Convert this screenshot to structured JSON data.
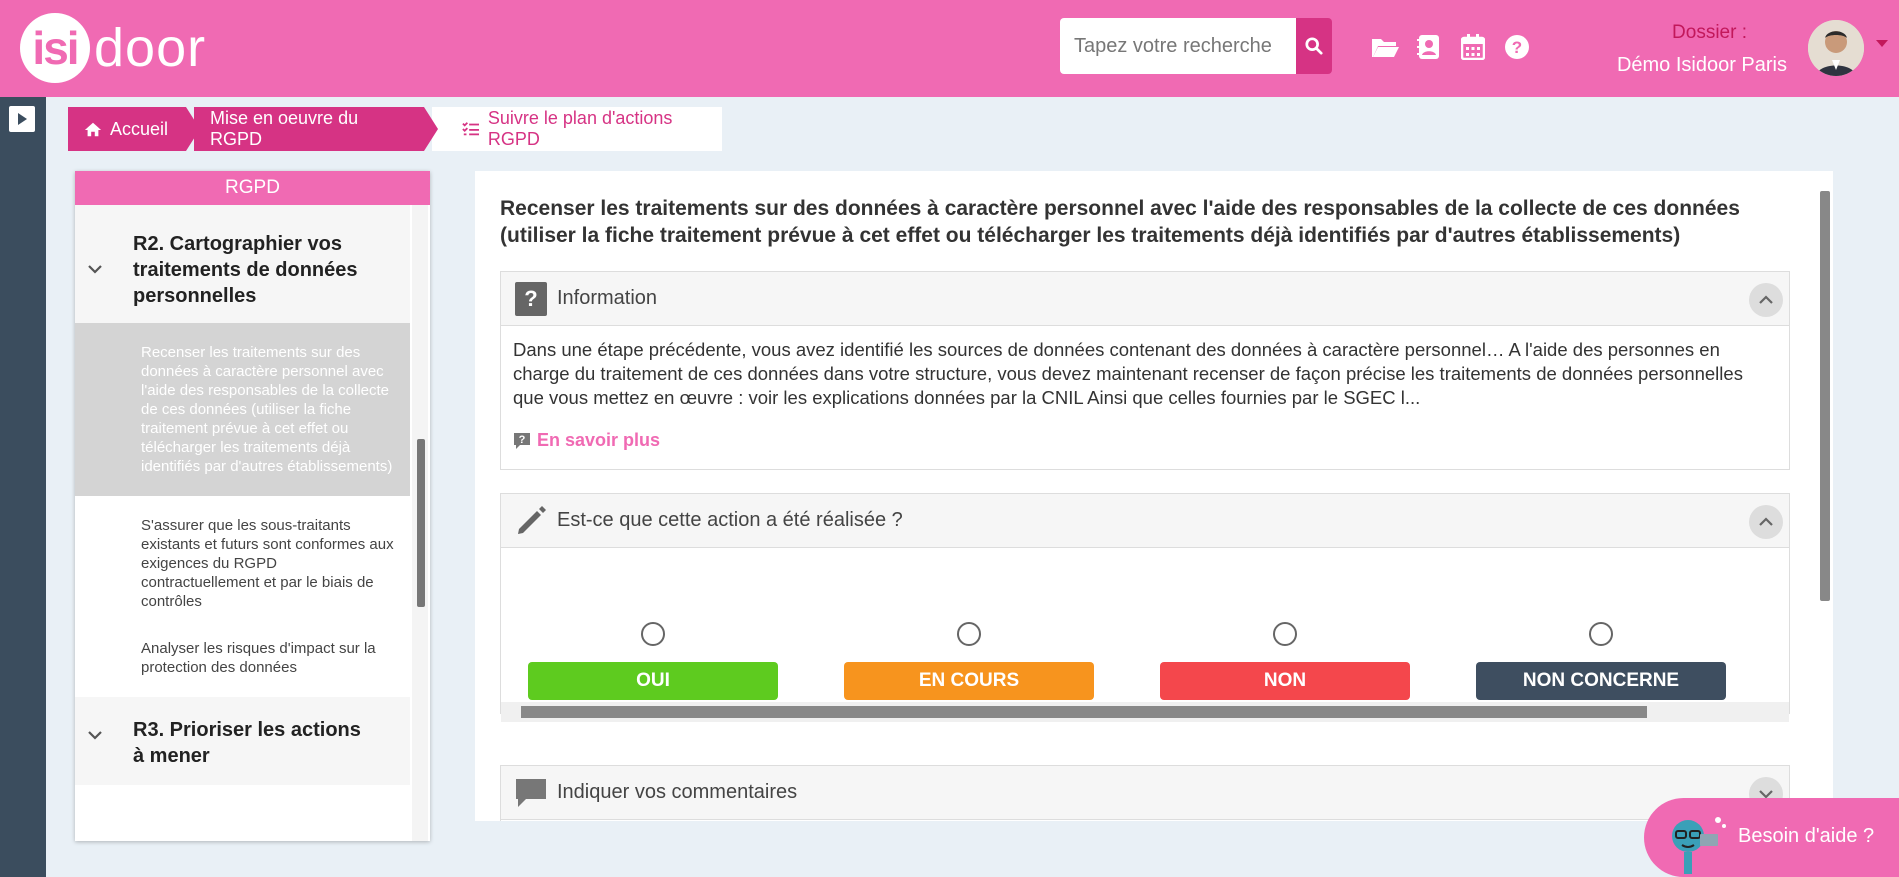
{
  "header": {
    "logo_prefix": "isi",
    "logo_suffix": "door",
    "search_placeholder": "Tapez votre recherche",
    "dossier_label": "Dossier :",
    "dossier_name": "Démo Isidoor Paris",
    "icons": [
      "folder-open-icon",
      "address-book-icon",
      "calendar-icon",
      "help-circle-icon"
    ]
  },
  "breadcrumb": {
    "home": "Accueil",
    "level2": "Mise en oeuvre du RGPD",
    "level3": "Suivre le plan d'actions RGPD"
  },
  "sidebar": {
    "title": "RGPD",
    "sections": [
      {
        "title": "R2. Cartographier vos traitements de données personnelles",
        "items": [
          "Recenser les traitements sur des données à caractère personnel (utiliser la fiche traitement prévue à cet effet ou télécharger les traitements déjà identifiés par d'autres établissements)",
          "S'assurer que les sous-traitants existants et futurs sont conformes aux exigences du RGPD contractuellement et par le biais de contrôles",
          "Analyser les risques d'impact sur la protection des données"
        ]
      },
      {
        "title": "R3. Prioriser les actions à mener",
        "items": []
      }
    ],
    "active_item": "Recenser les traitements sur des données à caractère personnel avec l'aide des responsables de la collecte de ces données (utiliser la fiche traitement prévue à cet effet ou télécharger les traitements déjà identifiés par d'autres établissements)"
  },
  "main": {
    "title": "Recenser les traitements sur des données à caractère personnel avec l'aide des responsables de la collecte de ces données (utiliser la fiche traitement prévue à cet effet ou télécharger les traitements déjà identifiés par d'autres établissements)",
    "info_panel": {
      "heading": "Information",
      "text": "Dans une étape précédente, vous avez identifié les sources de données contenant des données à caractère personnel… A l'aide des personnes en charge du traitement de ces données dans votre structure, vous devez maintenant recenser de façon précise les traitements de données personnelles que vous mettez en œuvre : voir les explications données par la CNIL Ainsi que celles fournies par le SGEC l...",
      "more_link": "En savoir plus"
    },
    "action_panel": {
      "heading": "Est-ce que cette action a été réalisée ?",
      "options": [
        {
          "label": "OUI",
          "color": "#5ecb1f"
        },
        {
          "label": "EN COURS",
          "color": "#f7941e"
        },
        {
          "label": "NON",
          "color": "#f4474c"
        },
        {
          "label": "NON CONCERNE",
          "color": "#3e4e60"
        }
      ]
    },
    "comment_panel": {
      "heading": "Indiquer vos commentaires"
    }
  },
  "help_widget": {
    "label": "Besoin d'aide ?"
  },
  "colors": {
    "brand_pink": "#f06ab3",
    "accent_magenta": "#d63384",
    "rail": "#3b4d5e"
  }
}
